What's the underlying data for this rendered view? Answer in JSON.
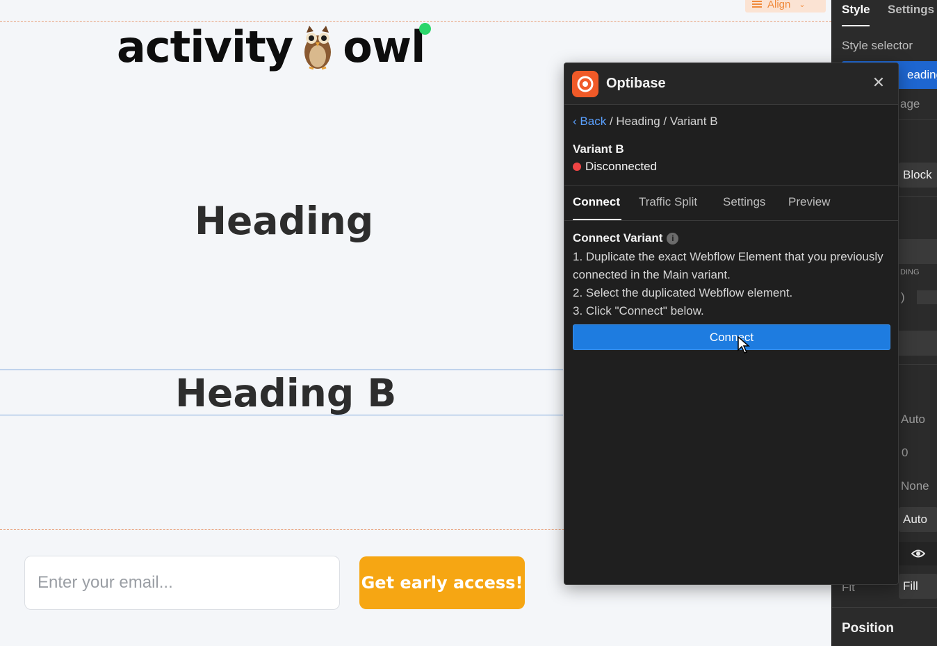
{
  "canvas": {
    "toolbar": {
      "align_label": "Align"
    },
    "logo": {
      "word_left": "activity",
      "word_right": "owl",
      "owl_icon": "owl-emoji"
    },
    "heading_a": "Heading",
    "heading_b": "Heading B",
    "signup": {
      "email_placeholder": "Enter your email...",
      "cta_label": "Get early access!"
    },
    "colors": {
      "cta": "#f6a613",
      "status_dot": "#2bd66b"
    }
  },
  "style_panel": {
    "tabs": [
      "Style",
      "Settings"
    ],
    "style_selector_label": "Style selector",
    "selector_value": "eading",
    "selector_page": "age",
    "display_value": "Block",
    "padding_label": "DING",
    "padding_value": ")",
    "fields": [
      "Auto",
      "0",
      "None",
      "Auto",
      "Fill"
    ],
    "fit_label": "Fit",
    "section_position": "Position"
  },
  "optibase": {
    "title": "Optibase",
    "breadcrumb": {
      "back": "Back",
      "rest": "/ Heading / Variant B"
    },
    "variant_name": "Variant B",
    "status": "Disconnected",
    "tabs": [
      "Connect",
      "Traffic Split",
      "Settings",
      "Preview"
    ],
    "active_tab": "Connect",
    "section_title": "Connect Variant",
    "steps": [
      "1. Duplicate the exact Webflow Element that you previously connected in the Main variant.",
      "2. Select the duplicated Webflow element.",
      "3. Click \"Connect\" below."
    ],
    "connect_button": "Connect",
    "colors": {
      "brand": "#f05a28",
      "button": "#1e7ce0",
      "disconnected": "#ef4444"
    }
  }
}
